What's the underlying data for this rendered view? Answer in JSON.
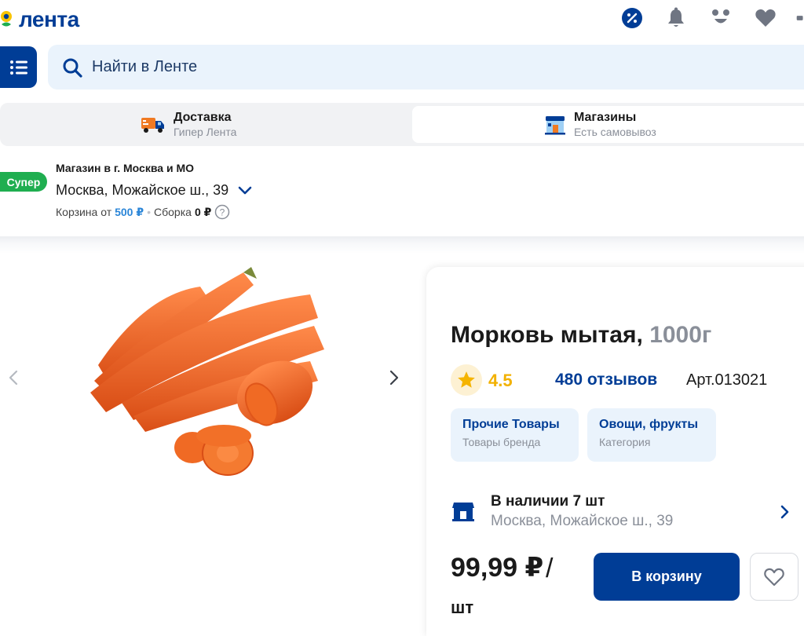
{
  "header": {
    "logo_text": "лента",
    "icons": [
      "percent-icon",
      "bell-icon",
      "profile-icon",
      "heart-icon"
    ]
  },
  "search": {
    "placeholder": "Найти в Ленте"
  },
  "tabs": [
    {
      "title": "Доставка",
      "subtitle": "Гипер Лента"
    },
    {
      "title": "Магазины",
      "subtitle": "Есть самовывоз"
    }
  ],
  "store": {
    "badge": "Супер",
    "label": "Магазин в г. Москва и МО",
    "address": "Москва, Можайское ш., 39",
    "cart_prefix": "Корзина от",
    "cart_min": "500 ₽",
    "dot": "•",
    "assembly_prefix": "Сборка",
    "assembly_price": "0 ₽"
  },
  "product": {
    "name": "Морковь мытая,",
    "weight": "1000г",
    "rating": "4.5",
    "reviews": "480 отзывов",
    "article": "Арт.013021",
    "chips": [
      {
        "title": "Прочие Товары",
        "subtitle": "Товары бренда"
      },
      {
        "title": "Овощи, фрукты",
        "subtitle": "Категория"
      }
    ],
    "availability": "В наличии 7 шт",
    "availability_address": "Москва, Можайское ш., 39",
    "price": "99,99 ₽",
    "price_sep": "/",
    "unit": "шт",
    "cart_button": "В корзину"
  },
  "colors": {
    "brand": "#003d96",
    "accent_yellow": "#f2b100",
    "badge_green": "#1fae50",
    "carrot": "#f0682a"
  }
}
